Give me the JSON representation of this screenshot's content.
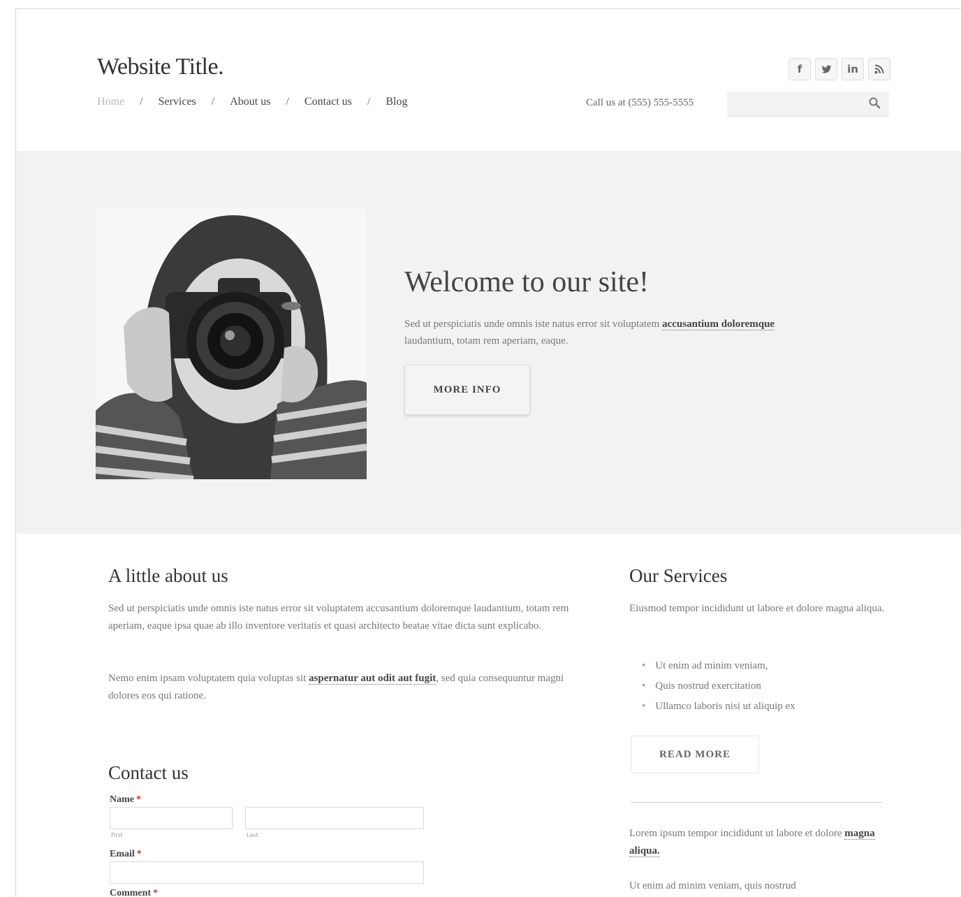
{
  "header": {
    "site_title": "Website Title.",
    "social": [
      "f",
      "t",
      "in",
      "rss"
    ],
    "nav": [
      {
        "label": "Home",
        "active": true
      },
      {
        "label": "Services"
      },
      {
        "label": "About us"
      },
      {
        "label": "Contact us"
      },
      {
        "label": "Blog"
      }
    ],
    "nav_separator": "/",
    "call_us": "Call us at (555) 555-5555",
    "search_placeholder": ""
  },
  "hero": {
    "title": "Welcome to our site!",
    "text_before": "Sed ut perspiciatis unde omnis iste natus error sit voluptatem ",
    "text_link": "accusantium doloremque",
    "text_after": " laudantium, totam rem aperiam, eaque.",
    "button": "MORE INFO"
  },
  "about": {
    "title": "A little about us",
    "para1": "Sed ut perspiciatis unde omnis iste natus error sit voluptatem accusantium doloremque laudantium, totam rem aperiam, eaque ipsa quae ab illo inventore veritatis et quasi architecto beatae vitae dicta sunt explicabo.",
    "para2_before": "Nemo enim ipsam voluptatem quia voluptas sit ",
    "para2_link": "aspernatur aut odit aut fugit",
    "para2_after": ", sed quia consequuntur magni dolores eos qui ratione."
  },
  "services": {
    "title": "Our Services",
    "intro": "Eiusmod tempor incididunt ut labore et dolore magna aliqua.",
    "items": [
      "Ut enim ad minim veniam,",
      "Quis nostrud exercitation",
      "Ullamco laboris nisi ut aliquip ex"
    ],
    "button": "READ MORE",
    "text2_before": "Lorem ipsum tempor incididunt ut labore et dolore ",
    "text2_link": "magna aliqua.",
    "text3": "Ut enim ad minim veniam, quis nostrud"
  },
  "contact": {
    "title": "Contact us",
    "name_label": "Name",
    "first_label": "First",
    "last_label": "Last",
    "email_label": "Email",
    "comment_label": "Comment",
    "required_mark": "*"
  }
}
